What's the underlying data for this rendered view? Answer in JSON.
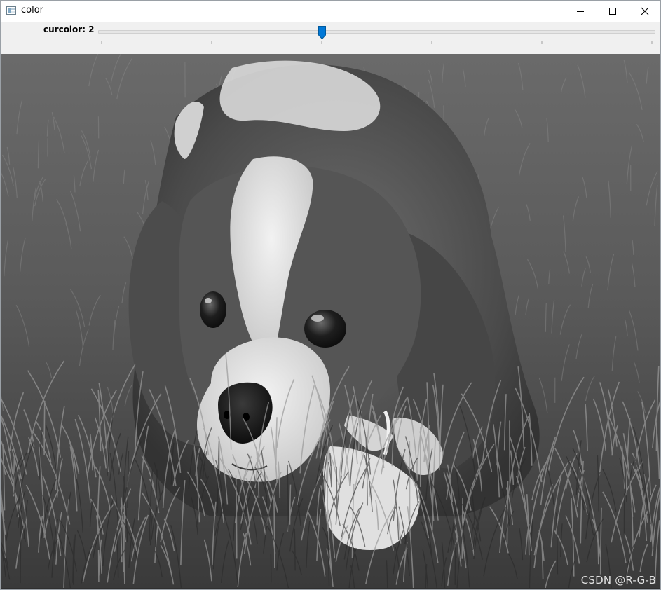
{
  "window": {
    "title": "color",
    "icons": {
      "app": "opencv-window-icon",
      "minimize": "minimize-icon",
      "maximize": "maximize-icon",
      "close": "close-icon"
    }
  },
  "trackbar": {
    "label": "curcolor: 2",
    "value": 2,
    "min": 0,
    "max": 5,
    "tick_count": 6,
    "accent_color": "#0078d7"
  },
  "image": {
    "description_type": "grayscale-photo",
    "watermark": "CSDN @R-G-B"
  }
}
